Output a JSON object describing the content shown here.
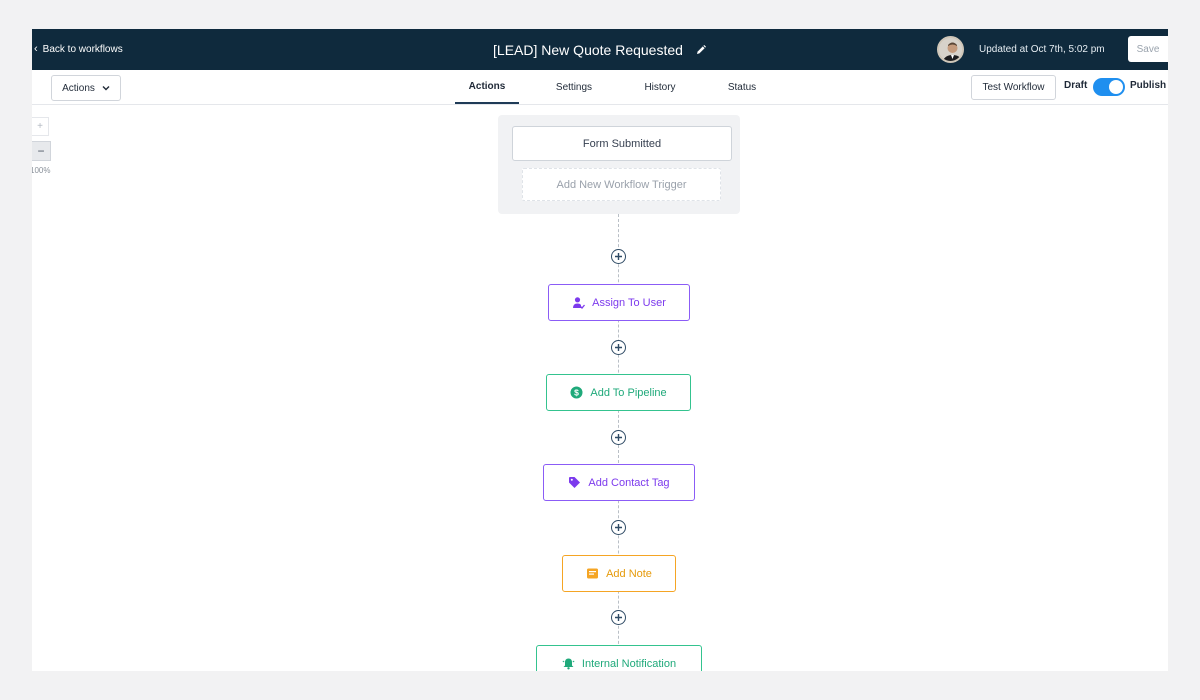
{
  "topbar": {
    "back_label": "Back to workflows",
    "title": "[LEAD] New Quote Requested",
    "updated": "Updated at Oct 7th, 5:02 pm",
    "save_label": "Save"
  },
  "subbar": {
    "actions_dropdown": "Actions",
    "tabs": [
      {
        "label": "Actions",
        "active": true
      },
      {
        "label": "Settings",
        "active": false
      },
      {
        "label": "History",
        "active": false
      },
      {
        "label": "Status",
        "active": false
      }
    ],
    "test_workflow": "Test Workflow",
    "draft_label": "Draft",
    "publish_label": "Publish",
    "published": true
  },
  "zoom": {
    "in_label": "+",
    "out_label": "−",
    "level": "100%"
  },
  "trigger": {
    "card_label": "Form Submitted",
    "add_trigger_label": "Add New Workflow Trigger"
  },
  "actions": [
    {
      "label": "Assign To User",
      "icon": "user-assign-icon",
      "color": "#7c3aed"
    },
    {
      "label": "Add To Pipeline",
      "icon": "dollar-circle-icon",
      "color": "#1fa97a"
    },
    {
      "label": "Add Contact Tag",
      "icon": "tag-icon",
      "color": "#7c3aed"
    },
    {
      "label": "Add Note",
      "icon": "note-icon",
      "color": "#e69a0a"
    },
    {
      "label": "Internal Notification",
      "icon": "bell-icon",
      "color": "#1fa97a"
    }
  ],
  "colors": {
    "topbar_bg": "#0f2a3d",
    "toggle_on": "#1f8fef"
  }
}
